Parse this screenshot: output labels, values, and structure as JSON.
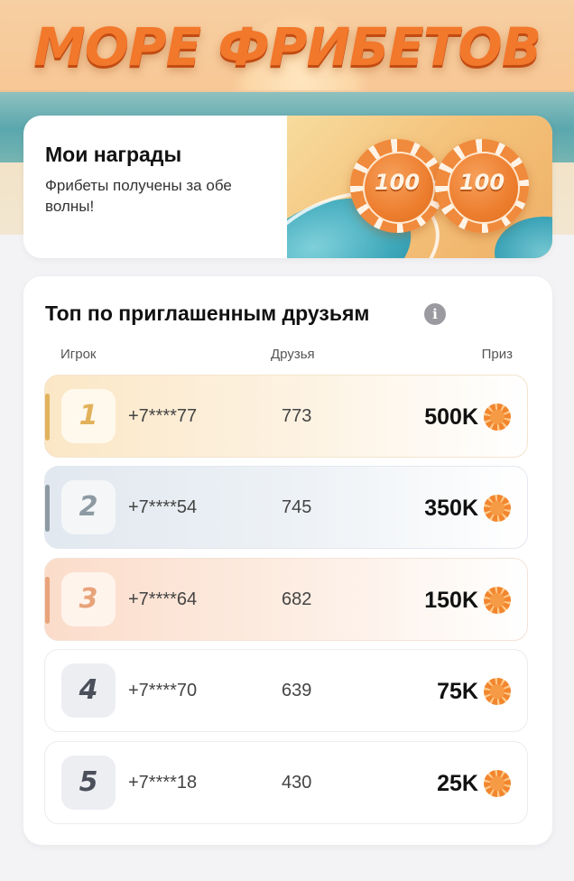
{
  "banner": {
    "logo_text": "МОРЕ ФРИБЕТОВ"
  },
  "rewards": {
    "title": "Мои награды",
    "subtitle": "Фрибеты получены за обе волны!",
    "chips": [
      "100",
      "100"
    ]
  },
  "leaderboard": {
    "title": "Топ по приглашенным друзьям",
    "info_icon": "info-icon",
    "columns": {
      "player": "Игрок",
      "friends": "Друзья",
      "prize": "Приз"
    },
    "rows": [
      {
        "rank": "1",
        "phone": "+7****77",
        "friends": "773",
        "prize": "500K"
      },
      {
        "rank": "2",
        "phone": "+7****54",
        "friends": "745",
        "prize": "350K"
      },
      {
        "rank": "3",
        "phone": "+7****64",
        "friends": "682",
        "prize": "150K"
      },
      {
        "rank": "4",
        "phone": "+7****70",
        "friends": "639",
        "prize": "75K"
      },
      {
        "rank": "5",
        "phone": "+7****18",
        "friends": "430",
        "prize": "25K"
      }
    ]
  },
  "colors": {
    "accent_orange": "#f2782c",
    "gold": "#e0b25c",
    "silver": "#8d9aa3",
    "bronze": "#e8a37a"
  }
}
